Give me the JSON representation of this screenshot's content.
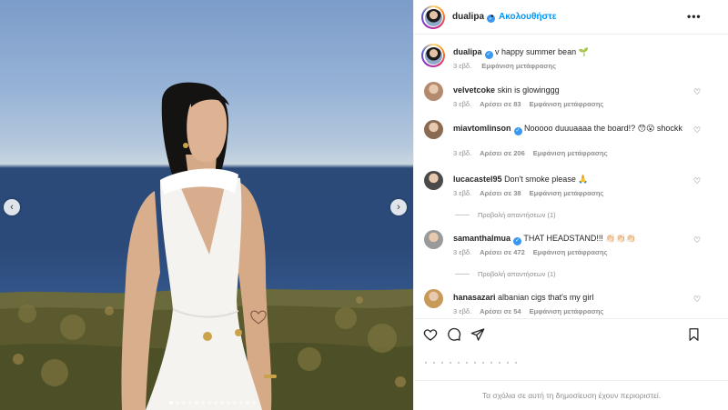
{
  "post": {
    "author": "dualipa",
    "follow_label": "Ακολουθήστε",
    "separator": "•",
    "more_icon": "more-horizontal-icon",
    "verified_icon": "verified-badge-icon"
  },
  "caption": {
    "username": "dualipa",
    "text": "v happy summer bean 🌱",
    "age": "3 εβδ.",
    "translate": "Εμφάνιση μετάφρασης"
  },
  "comments": [
    {
      "username": "velvetcoke",
      "verified": false,
      "text": "skin is glowinggg",
      "age": "3 εβδ.",
      "likes": "Αρέσει σε 83",
      "translate": "Εμφάνιση μετάφρασης",
      "avatar_color": "#b48a6e"
    },
    {
      "username": "miavtomlinson",
      "verified": true,
      "text": "Nooooo duuuaaaa the board!? 😯😮 shockk",
      "age": "3 εβδ.",
      "likes": "Αρέσει σε 206",
      "translate": "Εμφάνιση μετάφρασης",
      "avatar_color": "#8a6a50"
    },
    {
      "username": "lucacastel95",
      "verified": false,
      "text": "Don't smoke please 🙏",
      "age": "3 εβδ.",
      "likes": "Αρέσει σε 38",
      "translate": "Εμφάνιση μετάφρασης",
      "replies": "Προβολή απαντήσεων (1)",
      "avatar_color": "#4a4a4a"
    },
    {
      "username": "samanthalmua",
      "verified": true,
      "text": "THAT HEADSTAND!!! 👏🏻👏🏻👏🏻",
      "age": "3 εβδ.",
      "likes": "Αρέσει σε 472",
      "translate": "Εμφάνιση μετάφρασης",
      "replies": "Προβολή απαντήσεων (1)",
      "avatar_color": "#9a9a9a"
    },
    {
      "username": "hanasazari",
      "verified": false,
      "text": "albanian cigs that's my girl",
      "age": "3 εβδ.",
      "likes": "Αρέσει σε 54",
      "translate": "Εμφάνιση μετάφρασης",
      "avatar_color": "#c79a5a"
    }
  ],
  "actions": {
    "like_icon": "heart-icon",
    "comment_icon": "comment-icon",
    "share_icon": "send-icon",
    "save_icon": "bookmark-icon"
  },
  "footer": {
    "text": "Τα σχόλια σε αυτή τη δημοσίευση έχουν περιοριστεί."
  },
  "carousel": {
    "total": 14,
    "active": 0
  },
  "colors": {
    "link": "#0095f6",
    "verified": "#3897f0",
    "muted": "#8e8e8e"
  }
}
